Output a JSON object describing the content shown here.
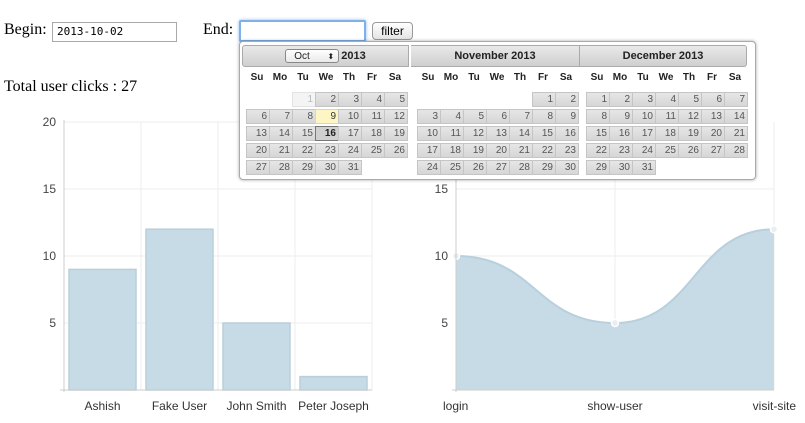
{
  "form": {
    "begin_label": "Begin:",
    "begin_value": "2013-10-02",
    "end_label": "End:",
    "end_value": "",
    "filter_label": "filter"
  },
  "total_clicks_text": "Total user clicks : 27",
  "datepicker": {
    "day_names": [
      "Su",
      "Mo",
      "Tu",
      "We",
      "Th",
      "Fr",
      "Sa"
    ],
    "month_select_value": "Oct",
    "months": [
      {
        "title": "2013",
        "first_weekday": 2,
        "days": 31,
        "today": 9,
        "selected": 16,
        "disabled_before": 2
      },
      {
        "title": "November 2013",
        "first_weekday": 5,
        "days": 30
      },
      {
        "title": "December 2013",
        "first_weekday": 0,
        "days": 31
      }
    ]
  },
  "colors": {
    "area": "#c7dbe6",
    "stroke": "#b8cfdc",
    "grid": "#eeeeee",
    "axis": "#cccccc"
  },
  "chart_data": [
    {
      "type": "bar",
      "categories": [
        "Ashish",
        "Fake User",
        "John Smith",
        "Peter Joseph"
      ],
      "values": [
        9,
        12,
        5,
        1
      ],
      "ylim": [
        0,
        20
      ],
      "yticks": [
        5,
        10,
        15,
        20
      ],
      "grid": true
    },
    {
      "type": "area",
      "categories": [
        "login",
        "show-user",
        "visit-site"
      ],
      "values": [
        10,
        5,
        12
      ],
      "ylim": [
        0,
        20
      ],
      "yticks": [
        5,
        10,
        15
      ],
      "grid": true
    }
  ]
}
